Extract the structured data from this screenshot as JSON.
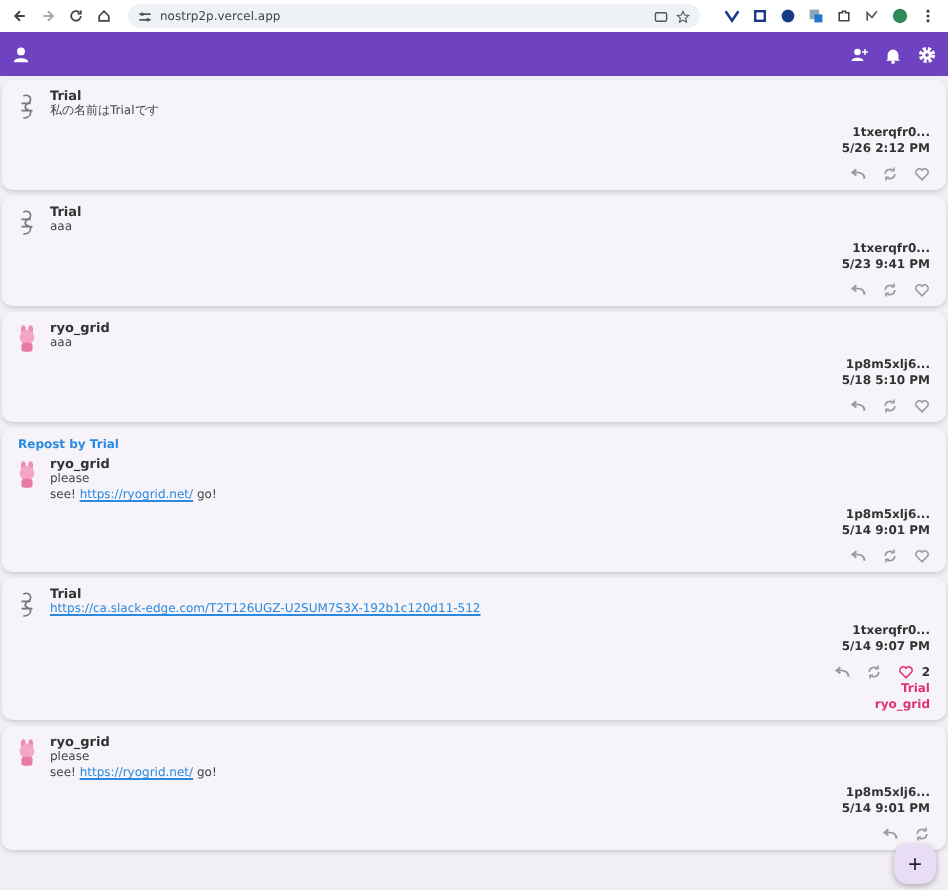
{
  "browser": {
    "url": "nostrp2p.vercel.app"
  },
  "posts": [
    {
      "author": "Trial",
      "avatar": {
        "kind": "sketch"
      },
      "lines": [
        [
          {
            "text": "私の名前はTrialです"
          }
        ]
      ],
      "pubkey": "1txerqfr0...",
      "time": "5/26 2:12 PM",
      "liked": false
    },
    {
      "author": "Trial",
      "avatar": {
        "kind": "sketch"
      },
      "lines": [
        [
          {
            "text": "aaa"
          }
        ]
      ],
      "pubkey": "1txerqfr0...",
      "time": "5/23 9:41 PM",
      "liked": false
    },
    {
      "author": "ryo_grid",
      "avatar": {
        "kind": "pink"
      },
      "lines": [
        [
          {
            "text": "aaa"
          }
        ]
      ],
      "pubkey": "1p8m5xlj6...",
      "time": "5/18 5:10 PM",
      "liked": false
    },
    {
      "repost_by": "Repost by Trial",
      "author": "ryo_grid",
      "avatar": {
        "kind": "pink"
      },
      "lines": [
        [
          {
            "text": "please"
          }
        ],
        [
          {
            "text": "see! "
          },
          {
            "text": "https://ryogrid.net/",
            "kind": "link"
          },
          {
            "text": " go!"
          }
        ]
      ],
      "pubkey": "1p8m5xlj6...",
      "time": "5/14 9:01 PM",
      "liked": false
    },
    {
      "author": "Trial",
      "avatar": {
        "kind": "sketch"
      },
      "lines": [
        [
          {
            "text": "https://ca.slack-edge.com/T2T126UGZ-U2SUM7S3X-192b1c120d11-512",
            "kind": "link"
          }
        ]
      ],
      "pubkey": "1txerqfr0...",
      "time": "5/14 9:07 PM",
      "liked": true,
      "like_count": "2",
      "likers": [
        "Trial",
        "ryo_grid"
      ]
    },
    {
      "author": "ryo_grid",
      "avatar": {
        "kind": "pink"
      },
      "lines": [
        [
          {
            "text": "please"
          }
        ],
        [
          {
            "text": "see! "
          },
          {
            "text": "https://ryogrid.net/",
            "kind": "link"
          },
          {
            "text": " go!"
          }
        ]
      ],
      "pubkey": "1p8m5xlj6...",
      "time": "5/14 9:01 PM"
    }
  ],
  "fab": {
    "label": "+"
  }
}
